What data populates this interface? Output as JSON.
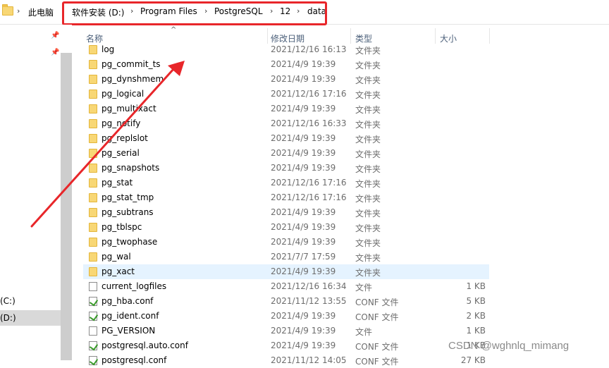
{
  "breadcrumb": {
    "root": "此电脑",
    "items": [
      "软件安装 (D:)",
      "Program Files",
      "PostgreSQL",
      "12",
      "data"
    ],
    "separator": "›"
  },
  "columns": {
    "name": "名称",
    "date": "修改日期",
    "type": "类型",
    "size": "大小"
  },
  "nav": {
    "drive_c": "(C:)",
    "drive_d": "(D:)"
  },
  "files": [
    {
      "name": "log",
      "date": "2021/12/16 16:13",
      "type": "文件夹",
      "size": "",
      "kind": "folder"
    },
    {
      "name": "pg_commit_ts",
      "date": "2021/4/9 19:39",
      "type": "文件夹",
      "size": "",
      "kind": "folder"
    },
    {
      "name": "pg_dynshmem",
      "date": "2021/4/9 19:39",
      "type": "文件夹",
      "size": "",
      "kind": "folder"
    },
    {
      "name": "pg_logical",
      "date": "2021/12/16 17:16",
      "type": "文件夹",
      "size": "",
      "kind": "folder"
    },
    {
      "name": "pg_multixact",
      "date": "2021/4/9 19:39",
      "type": "文件夹",
      "size": "",
      "kind": "folder"
    },
    {
      "name": "pg_notify",
      "date": "2021/12/16 16:33",
      "type": "文件夹",
      "size": "",
      "kind": "folder"
    },
    {
      "name": "pg_replslot",
      "date": "2021/4/9 19:39",
      "type": "文件夹",
      "size": "",
      "kind": "folder"
    },
    {
      "name": "pg_serial",
      "date": "2021/4/9 19:39",
      "type": "文件夹",
      "size": "",
      "kind": "folder"
    },
    {
      "name": "pg_snapshots",
      "date": "2021/4/9 19:39",
      "type": "文件夹",
      "size": "",
      "kind": "folder"
    },
    {
      "name": "pg_stat",
      "date": "2021/12/16 17:16",
      "type": "文件夹",
      "size": "",
      "kind": "folder"
    },
    {
      "name": "pg_stat_tmp",
      "date": "2021/12/16 17:16",
      "type": "文件夹",
      "size": "",
      "kind": "folder"
    },
    {
      "name": "pg_subtrans",
      "date": "2021/4/9 19:39",
      "type": "文件夹",
      "size": "",
      "kind": "folder"
    },
    {
      "name": "pg_tblspc",
      "date": "2021/4/9 19:39",
      "type": "文件夹",
      "size": "",
      "kind": "folder"
    },
    {
      "name": "pg_twophase",
      "date": "2021/4/9 19:39",
      "type": "文件夹",
      "size": "",
      "kind": "folder"
    },
    {
      "name": "pg_wal",
      "date": "2021/7/7 17:59",
      "type": "文件夹",
      "size": "",
      "kind": "folder"
    },
    {
      "name": "pg_xact",
      "date": "2021/4/9 19:39",
      "type": "文件夹",
      "size": "",
      "kind": "folder",
      "hover": true
    },
    {
      "name": "current_logfiles",
      "date": "2021/12/16 16:34",
      "type": "文件",
      "size": "1 KB",
      "kind": "file"
    },
    {
      "name": "pg_hba.conf",
      "date": "2021/11/12 13:55",
      "type": "CONF 文件",
      "size": "5 KB",
      "kind": "conf"
    },
    {
      "name": "pg_ident.conf",
      "date": "2021/4/9 19:39",
      "type": "CONF 文件",
      "size": "2 KB",
      "kind": "conf"
    },
    {
      "name": "PG_VERSION",
      "date": "2021/4/9 19:39",
      "type": "文件",
      "size": "1 KB",
      "kind": "file"
    },
    {
      "name": "postgresql.auto.conf",
      "date": "2021/4/9 19:39",
      "type": "CONF 文件",
      "size": "1 KB",
      "kind": "conf"
    },
    {
      "name": "postgresql.conf",
      "date": "2021/11/12 14:05",
      "type": "CONF 文件",
      "size": "27 KB",
      "kind": "conf"
    }
  ],
  "watermark": "CSDN @wghnlq_mimang",
  "colors": {
    "highlight": "#e8262a",
    "arrow": "#e8262a",
    "hover_row": "#e5f3ff"
  }
}
